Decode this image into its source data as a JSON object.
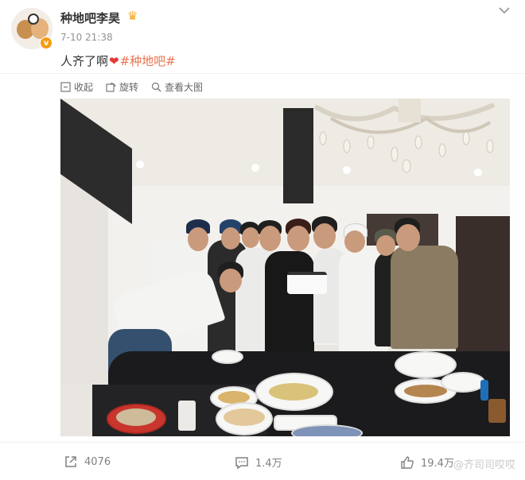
{
  "post": {
    "username": "种地吧李昊",
    "timestamp": "7-10 21:38",
    "text_before": "人齐了啊",
    "hashtag": "#种地吧#"
  },
  "tools": {
    "collapse": "收起",
    "rotate": "旋转",
    "view_large": "查看大图"
  },
  "footer": {
    "share_count": "4076",
    "comment_count": "1.4万",
    "like_count": "19.4万"
  },
  "watermark": "@齐司司哎哎",
  "icons": {
    "more": "chevron-down-icon",
    "verify": "verified-badge-icon",
    "crown": "crown-icon",
    "heart": "heart-emoji-icon",
    "share": "share-icon",
    "comment": "comment-icon",
    "like": "thumbs-up-icon"
  },
  "colors": {
    "hashtag": "#eb7350",
    "heart": "#e53935",
    "verify": "#f39c12"
  }
}
